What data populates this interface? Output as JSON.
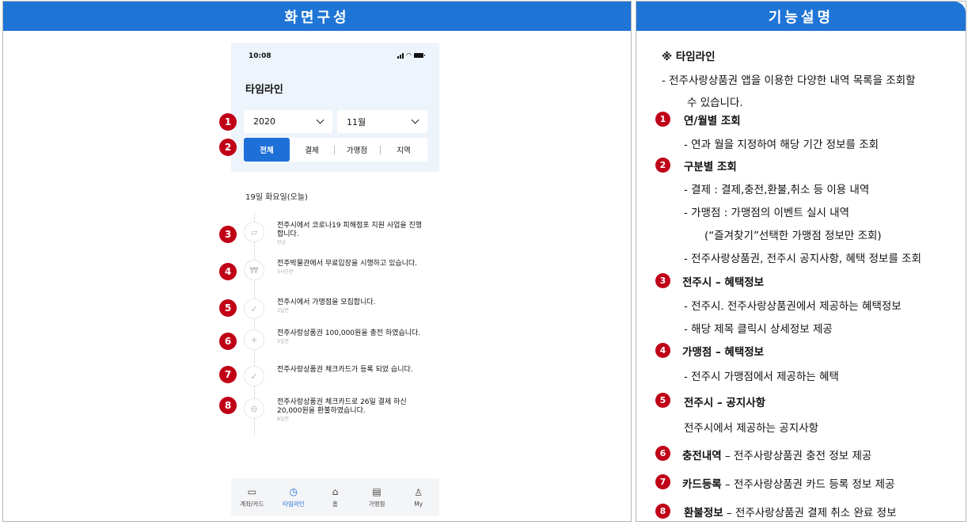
{
  "left_panel": {
    "title": "화면구성"
  },
  "right_panel": {
    "title": "기능설명"
  },
  "phone": {
    "status_time": "10:08",
    "app_title": "타임라인",
    "year_select": {
      "value": "2020"
    },
    "month_select": {
      "value": "11월"
    },
    "tabs": [
      "전체",
      "결제",
      "가맹점",
      "지역"
    ],
    "date_header": "19일 화요일(오늘)",
    "timeline": [
      {
        "icon": "map-icon",
        "text": "전주시에서 코로나19 피해점포 지원 사업을 진행합니다.",
        "time": "방금"
      },
      {
        "icon": "won-icon",
        "text": "전주박물관에서 무료입장을 시행하고 있습니다.",
        "time": "3시간전"
      },
      {
        "icon": "check-icon",
        "text": "전주시에서 가맹점을 모집합니다.",
        "time": "3일전"
      },
      {
        "icon": "plus-icon",
        "text": "전주사랑상품권 100,000원을 충전 하였습니다.",
        "time": "3일전"
      },
      {
        "icon": "check-icon",
        "text": "전주사랑상품권 체크카드가 등록 되었 습니다.",
        "time": ""
      },
      {
        "icon": "refund-icon",
        "text": "전주사랑상품권 체크카드로 26일 결제 하신 20,000원을 환불하였습니다.",
        "time": "8일전"
      }
    ],
    "nav": [
      {
        "label": "계좌/카드",
        "icon": "card-icon"
      },
      {
        "label": "타임라인",
        "icon": "clock-icon"
      },
      {
        "label": "홈",
        "icon": "home-icon"
      },
      {
        "label": "가맹점",
        "icon": "store-icon"
      },
      {
        "label": "My",
        "icon": "user-icon"
      }
    ],
    "markers": [
      "1",
      "2",
      "3",
      "4",
      "5",
      "6",
      "7",
      "8"
    ]
  },
  "description": {
    "section_title": "※ 타임라인",
    "intro_1": "-  전주사랑상품권 앱을 이용한 다양한 내역 목록을 조회할",
    "intro_2": "수 있습니다.",
    "items": [
      {
        "num": "1",
        "title": "연/월별 조회",
        "lines": [
          "-  연과 월을 지정하여 해당 기간 정보를 조회"
        ]
      },
      {
        "num": "2",
        "title": "구분별 조회",
        "lines": [
          "-  결제 : 결제,충전,환불,취소 등 이용 내역",
          "-  가맹점 : 가맹점의 이벤트 실시 내역",
          "(“즐겨찾기”선택한 가맹점 정보만 조회)",
          "- 전주사랑상품권, 전주시 공지사항, 혜택 정보를 조회"
        ]
      },
      {
        "num": "3",
        "title": "전주시 – 혜택정보",
        "lines": [
          "-  전주시. 전주사랑상품권에서 제공하는 혜택정보",
          "-  해당 제목 클릭시 상세정보 제공"
        ]
      },
      {
        "num": "4",
        "title": "가맹점 – 혜택정보",
        "lines": [
          "-  전주시 가맹점에서 제공하는 혜택"
        ]
      },
      {
        "num": "5",
        "title": "전주시 – 공지사항",
        "lines": [
          "전주시에서 제공하는 공지사항"
        ]
      },
      {
        "num": "6",
        "title": "충전내역",
        "rest": " – 전주사랑상품권 충전 정보 제공"
      },
      {
        "num": "7",
        "title": "카드등록",
        "rest": " – 전주사랑상품권 카드 등록 정보 제공"
      },
      {
        "num": "8",
        "title": "환불정보",
        "rest": " – 전주사랑상품권 결제 취소 완료 정보"
      }
    ]
  }
}
